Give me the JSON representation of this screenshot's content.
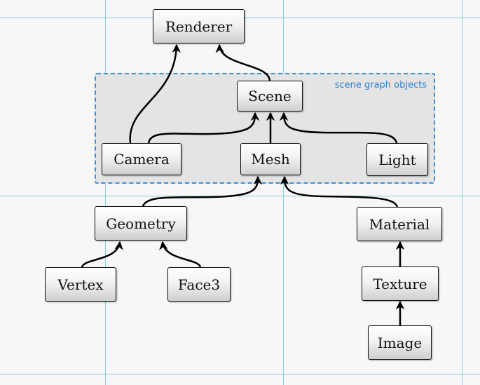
{
  "group": {
    "label": "scene graph objects",
    "border_color": "#3d8fd9"
  },
  "nodes": {
    "renderer": "Renderer",
    "scene": "Scene",
    "camera": "Camera",
    "mesh": "Mesh",
    "light": "Light",
    "geometry": "Geometry",
    "material": "Material",
    "vertex": "Vertex",
    "face3": "Face3",
    "texture": "Texture",
    "image": "Image"
  },
  "edges": [
    {
      "from": "Camera",
      "to": "Renderer"
    },
    {
      "from": "Scene",
      "to": "Renderer"
    },
    {
      "from": "Camera",
      "to": "Scene"
    },
    {
      "from": "Mesh",
      "to": "Scene"
    },
    {
      "from": "Light",
      "to": "Scene"
    },
    {
      "from": "Geometry",
      "to": "Mesh"
    },
    {
      "from": "Material",
      "to": "Mesh"
    },
    {
      "from": "Vertex",
      "to": "Geometry"
    },
    {
      "from": "Face3",
      "to": "Geometry"
    },
    {
      "from": "Texture",
      "to": "Material"
    },
    {
      "from": "Image",
      "to": "Texture"
    }
  ]
}
